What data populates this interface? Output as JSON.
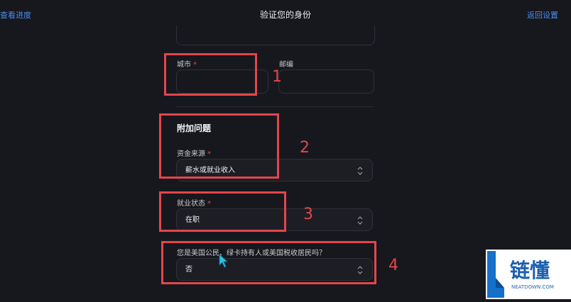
{
  "header": {
    "left_link": "查看进度",
    "title": "验证您的身份",
    "right_link": "返回设置"
  },
  "form": {
    "city": {
      "label": "城市",
      "required_mark": "*",
      "value": ""
    },
    "zip": {
      "label": "邮编",
      "value": ""
    },
    "section_title": "附加问题",
    "fund_source": {
      "label": "资金来源",
      "required_mark": "*",
      "value": "薪水或就业收入"
    },
    "employment": {
      "label": "就业状态",
      "required_mark": "*",
      "value": "在职"
    },
    "us_person": {
      "label": "您是美国公民、绿卡持有人或美国税收居民吗？",
      "value": "否"
    }
  },
  "annotations": [
    "1",
    "2",
    "3",
    "4"
  ],
  "annotation_color": "#e3464c",
  "accent_color": "#4b8cf0",
  "watermark": {
    "brand": "链懂",
    "domain": "NEATDOWN.COM"
  }
}
